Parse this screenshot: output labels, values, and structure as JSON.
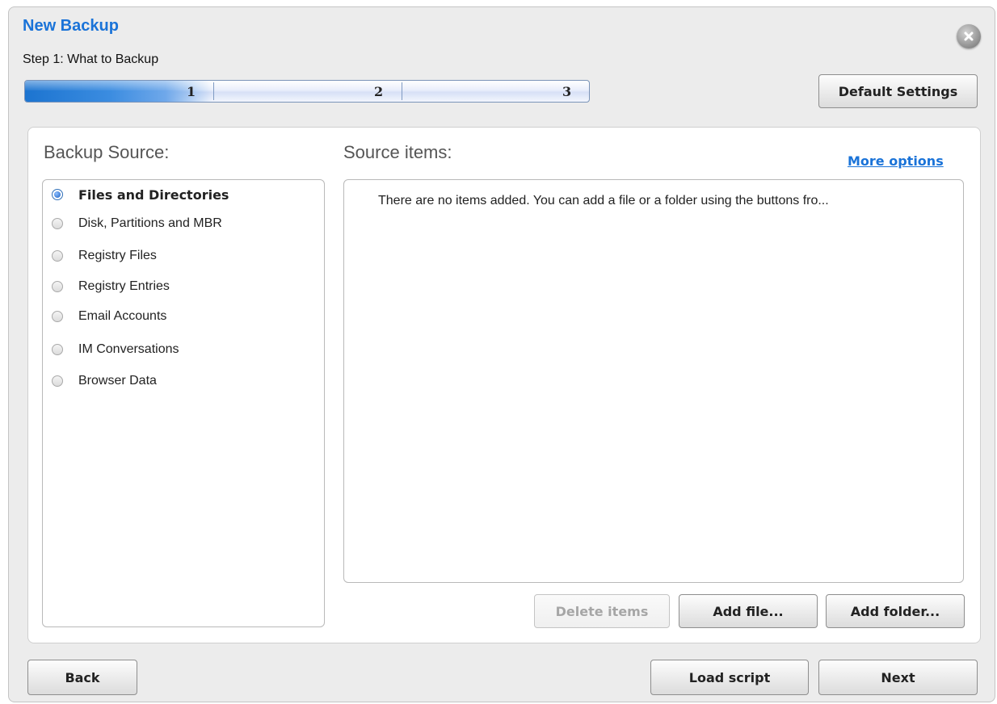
{
  "window": {
    "title": "New Backup",
    "step_label": "Step 1: What to Backup",
    "progress": {
      "current_step": 1,
      "steps": [
        "1",
        "2",
        "3"
      ],
      "fill_fraction": 0.33
    },
    "default_settings_label": "Default Settings"
  },
  "source": {
    "heading": "Backup Source:",
    "options": [
      {
        "label": "Files and Directories",
        "selected": true
      },
      {
        "label": "Disk, Partitions and MBR",
        "selected": false
      },
      {
        "label": "Registry Files",
        "selected": false
      },
      {
        "label": "Registry Entries",
        "selected": false
      },
      {
        "label": "Email Accounts",
        "selected": false
      },
      {
        "label": "IM Conversations",
        "selected": false
      },
      {
        "label": "Browser Data",
        "selected": false
      }
    ]
  },
  "items": {
    "heading": "Source items:",
    "more_options": "More options",
    "empty_message": "There are no items added. You can add a file or a folder using the buttons fro...",
    "delete_label": "Delete items",
    "add_file_label": "Add file...",
    "add_folder_label": "Add folder..."
  },
  "footer": {
    "back_label": "Back",
    "load_script_label": "Load script",
    "next_label": "Next"
  },
  "colors": {
    "accent": "#1a73d8",
    "progress_fill": "#1c74d0"
  },
  "icons": {
    "close": "close-icon"
  }
}
